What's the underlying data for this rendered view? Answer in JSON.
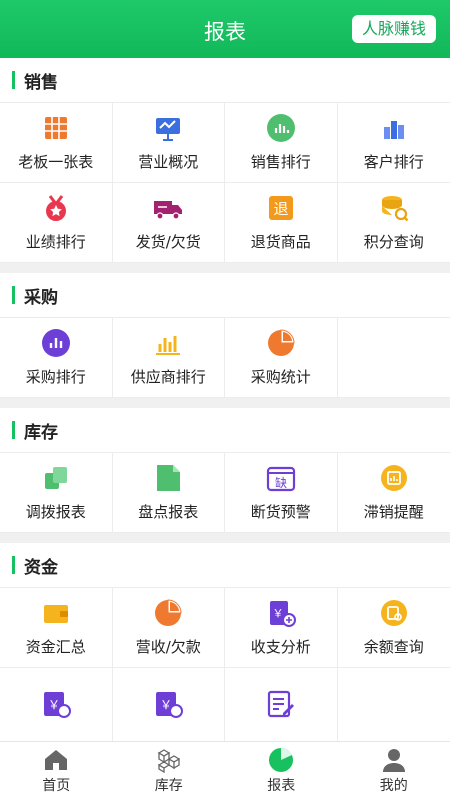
{
  "header": {
    "title": "报表",
    "action_label": "人脉赚钱"
  },
  "sections": [
    {
      "title": "销售",
      "items": [
        {
          "label": "老板一张表",
          "icon": "table-icon"
        },
        {
          "label": "营业概况",
          "icon": "presentation-icon"
        },
        {
          "label": "销售排行",
          "icon": "bar-chart-circle-icon"
        },
        {
          "label": "客户排行",
          "icon": "ranking-bars-icon"
        },
        {
          "label": "业绩排行",
          "icon": "medal-icon"
        },
        {
          "label": "发货/欠货",
          "icon": "truck-icon"
        },
        {
          "label": "退货商品",
          "icon": "return-icon"
        },
        {
          "label": "积分查询",
          "icon": "coins-search-icon"
        }
      ]
    },
    {
      "title": "采购",
      "items": [
        {
          "label": "采购排行",
          "icon": "bar-chart-purple-icon"
        },
        {
          "label": "供应商排行",
          "icon": "bar-chart-yellow-icon"
        },
        {
          "label": "采购统计",
          "icon": "pie-chart-icon"
        }
      ]
    },
    {
      "title": "库存",
      "items": [
        {
          "label": "调拨报表",
          "icon": "transfer-icon"
        },
        {
          "label": "盘点报表",
          "icon": "document-icon"
        },
        {
          "label": "断货预警",
          "icon": "shortage-icon",
          "glyph": "缺"
        },
        {
          "label": "滞销提醒",
          "icon": "slow-sale-icon"
        }
      ]
    },
    {
      "title": "资金",
      "items": [
        {
          "label": "资金汇总",
          "icon": "wallet-icon"
        },
        {
          "label": "营收/欠款",
          "icon": "pie-chart-orange-icon"
        },
        {
          "label": "收支分析",
          "icon": "income-expense-icon"
        },
        {
          "label": "余额查询",
          "icon": "balance-icon"
        },
        {
          "label": "",
          "icon": "yuan-sell-icon",
          "glyph": "￥"
        },
        {
          "label": "",
          "icon": "yuan-supply-icon",
          "glyph": "￥"
        },
        {
          "label": "",
          "icon": "edit-document-icon"
        }
      ]
    }
  ],
  "tabbar": [
    {
      "label": "首页",
      "icon": "home-icon"
    },
    {
      "label": "库存",
      "icon": "boxes-icon"
    },
    {
      "label": "报表",
      "icon": "report-pie-icon"
    },
    {
      "label": "我的",
      "icon": "user-icon"
    }
  ],
  "colors": {
    "primary": "#18c15f",
    "purple": "#6e3fd6",
    "orange": "#ef7a2f",
    "yellow": "#f5b41e"
  }
}
